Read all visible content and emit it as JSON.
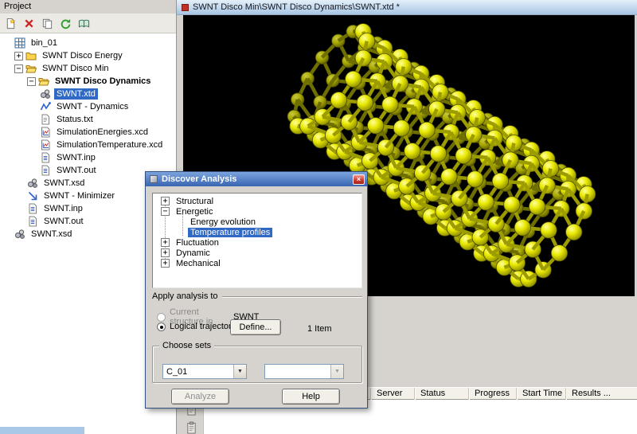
{
  "colors": {
    "selection": "#316ac5",
    "atom_color": "#e8e800",
    "canvas_bg": "#000000",
    "dialog_titlebar": "#3a6ab8",
    "viewer_titlebar": "#b7d0ea"
  },
  "project_panel": {
    "title": "Project",
    "toolbar_icons": [
      "new-document-icon",
      "delete-icon",
      "copy-icon",
      "refresh-icon",
      "library-icon"
    ],
    "tree": [
      {
        "label": "bin_01",
        "level": 1,
        "icon": "grid",
        "expand": "none"
      },
      {
        "label": "SWNT Disco Energy",
        "level": 1,
        "icon": "folder",
        "expand": "plus"
      },
      {
        "label": "SWNT Disco Min",
        "level": 1,
        "icon": "folder-open",
        "expand": "minus"
      },
      {
        "label": "SWNT Disco Dynamics",
        "level": 2,
        "icon": "folder-open",
        "expand": "minus",
        "bold": true
      },
      {
        "label": "SWNT.xtd",
        "level": 3,
        "icon": "molecule",
        "selected": true
      },
      {
        "label": "SWNT - Dynamics",
        "level": 3,
        "icon": "dynamics"
      },
      {
        "label": "Status.txt",
        "level": 3,
        "icon": "txt"
      },
      {
        "label": "SimulationEnergies.xcd",
        "level": 3,
        "icon": "chart"
      },
      {
        "label": "SimulationTemperature.xcd",
        "level": 3,
        "icon": "chart"
      },
      {
        "label": "SWNT.inp",
        "level": 3,
        "icon": "inp"
      },
      {
        "label": "SWNT.out",
        "level": 3,
        "icon": "inp"
      },
      {
        "label": "SWNT.xsd",
        "level": 2,
        "icon": "molecule"
      },
      {
        "label": "SWNT - Minimizer",
        "level": 2,
        "icon": "minimizer"
      },
      {
        "label": "SWNT.inp",
        "level": 2,
        "icon": "inp"
      },
      {
        "label": "SWNT.out",
        "level": 2,
        "icon": "inp"
      },
      {
        "label": "SWNT.xsd",
        "level": 1,
        "icon": "molecule"
      }
    ]
  },
  "viewer": {
    "title": "SWNT Disco Min\\SWNT Disco Dynamics\\SWNT.xtd *"
  },
  "dialog": {
    "title": "Discover Analysis",
    "tree": [
      {
        "label": "Structural",
        "level": 0,
        "expand": "plus"
      },
      {
        "label": "Energetic",
        "level": 0,
        "expand": "minus"
      },
      {
        "label": "Energy evolution",
        "level": 1
      },
      {
        "label": "Temperature profiles",
        "level": 1,
        "selected": true
      },
      {
        "label": "Fluctuation",
        "level": 0,
        "expand": "plus"
      },
      {
        "label": "Dynamic",
        "level": 0,
        "expand": "plus"
      },
      {
        "label": "Mechanical",
        "level": 0,
        "expand": "plus"
      }
    ],
    "apply": {
      "section_label": "Apply analysis to",
      "current_structure_label": "Current structure in",
      "current_structure_value": "SWNT",
      "trajectory_label": "Logical trajectory",
      "define_button": "Define...",
      "items_text": "1 Item"
    },
    "choose_sets": {
      "label": "Choose sets",
      "set_value": "C_01",
      "second_value": ""
    },
    "analyze_button": "Analyze",
    "help_button": "Help"
  },
  "jobs": {
    "columns": [
      "Server",
      "Status",
      "Progress",
      "Start Time",
      "Results ..."
    ]
  }
}
